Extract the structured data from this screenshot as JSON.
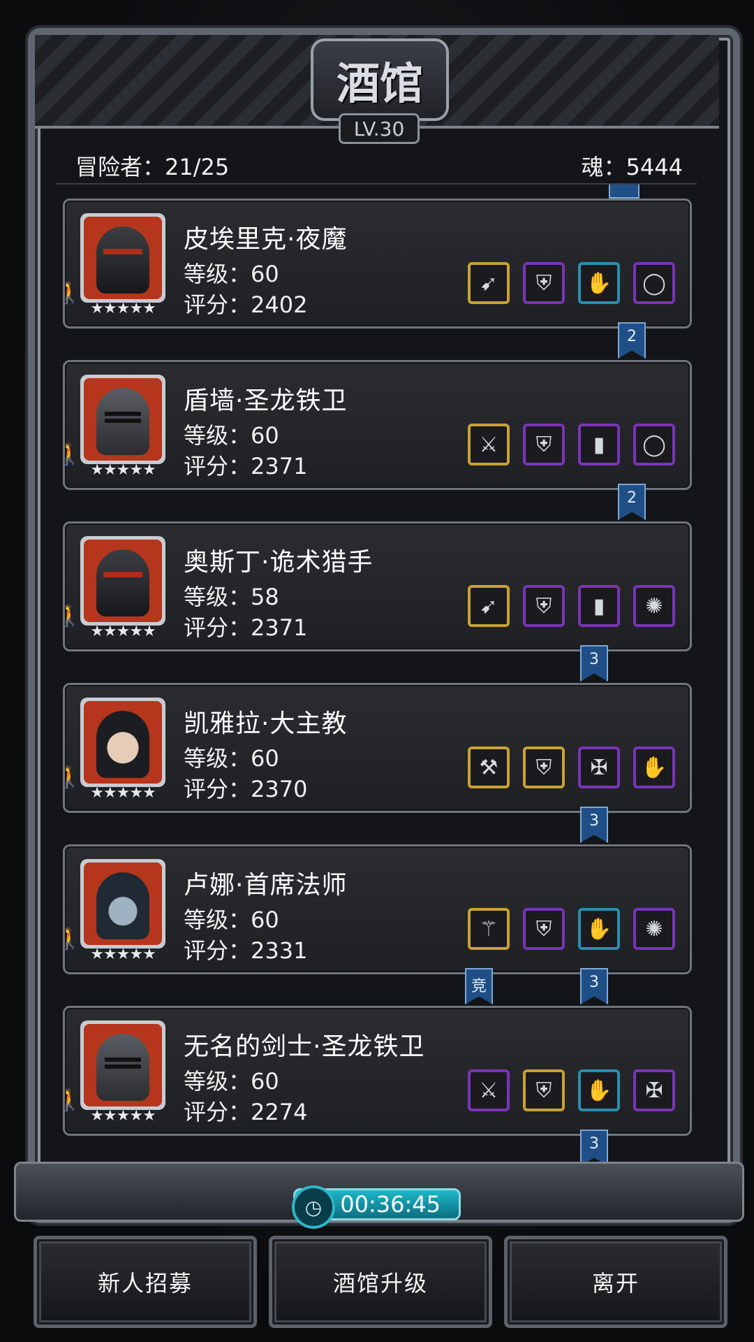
{
  "header": {
    "title": "酒馆",
    "level": "LV.30"
  },
  "stats": {
    "adventurers": "冒险者：21/25",
    "souls": "魂：5444"
  },
  "heroes": [
    {
      "name": "皮埃里克·夜魔",
      "level": "等级：60",
      "score": "评分：2402",
      "stars": "★★★★★",
      "portrait": "ninja-portrait-icon",
      "equipment": [
        {
          "icon": "curved-blade-icon",
          "glyph": "➹",
          "quality": "gold"
        },
        {
          "icon": "purple-armor-icon",
          "glyph": "⛨",
          "quality": "purple"
        },
        {
          "icon": "gauntlet-icon",
          "glyph": "✋",
          "quality": "blue"
        },
        {
          "icon": "ring-icon",
          "glyph": "◯",
          "quality": "purple"
        }
      ],
      "ribbons": [
        {
          "label": "2"
        }
      ]
    },
    {
      "name": "盾墙·圣龙铁卫",
      "level": "等级：60",
      "score": "评分：2371",
      "stars": "★★★★★",
      "portrait": "knight-portrait-icon",
      "equipment": [
        {
          "icon": "greatsword-icon",
          "glyph": "⚔",
          "quality": "gold"
        },
        {
          "icon": "plate-armor-icon",
          "glyph": "⛨",
          "quality": "purple"
        },
        {
          "icon": "wooden-shield-icon",
          "glyph": "▮",
          "quality": "purple"
        },
        {
          "icon": "ring-icon",
          "glyph": "◯",
          "quality": "purple"
        }
      ],
      "ribbons": [
        {
          "label": "2"
        }
      ]
    },
    {
      "name": "奥斯丁·诡术猎手",
      "level": "等级：58",
      "score": "评分：2371",
      "stars": "★★★★★",
      "portrait": "ninja-portrait-icon",
      "equipment": [
        {
          "icon": "curved-blade-icon",
          "glyph": "➹",
          "quality": "gold"
        },
        {
          "icon": "purple-armor-icon",
          "glyph": "⛨",
          "quality": "purple"
        },
        {
          "icon": "wooden-shield-icon",
          "glyph": "▮",
          "quality": "purple"
        },
        {
          "icon": "ruby-amulet-icon",
          "glyph": "✺",
          "quality": "purple"
        }
      ],
      "ribbons": [
        {
          "label": "3"
        }
      ]
    },
    {
      "name": "凯雅拉·大主教",
      "level": "等级：60",
      "score": "评分：2370",
      "stars": "★★★★★",
      "portrait": "priestess-portrait-icon",
      "equipment": [
        {
          "icon": "warhammer-icon",
          "glyph": "⚒",
          "quality": "gold"
        },
        {
          "icon": "purple-armor-icon",
          "glyph": "⛨",
          "quality": "gold"
        },
        {
          "icon": "cross-amulet-icon",
          "glyph": "✠",
          "quality": "purple"
        },
        {
          "icon": "gauntlet-icon",
          "glyph": "✋",
          "quality": "purple"
        }
      ],
      "ribbons": [
        {
          "label": "3"
        }
      ]
    },
    {
      "name": "卢娜·首席法师",
      "level": "等级：60",
      "score": "评分：2331",
      "stars": "★★★★★",
      "portrait": "mage-portrait-icon",
      "equipment": [
        {
          "icon": "staff-icon",
          "glyph": "⚚",
          "quality": "gold"
        },
        {
          "icon": "purple-armor-icon",
          "glyph": "⛨",
          "quality": "purple"
        },
        {
          "icon": "gauntlet-icon",
          "glyph": "✋",
          "quality": "blue"
        },
        {
          "icon": "ruby-amulet-icon",
          "glyph": "✺",
          "quality": "purple"
        }
      ],
      "ribbons": [
        {
          "label": "竞"
        },
        {
          "label": "3"
        }
      ]
    },
    {
      "name": "无名的剑士·圣龙铁卫",
      "level": "等级：60",
      "score": "评分：2274",
      "stars": "★★★★★",
      "portrait": "knight-portrait-icon",
      "equipment": [
        {
          "icon": "greatsword-icon",
          "glyph": "⚔",
          "quality": "purple"
        },
        {
          "icon": "leather-armor-icon",
          "glyph": "⛨",
          "quality": "gold"
        },
        {
          "icon": "gauntlet-icon",
          "glyph": "✋",
          "quality": "blue"
        },
        {
          "icon": "cross-amulet-icon",
          "glyph": "✠",
          "quality": "purple"
        }
      ],
      "ribbons": [
        {
          "label": "3"
        }
      ]
    }
  ],
  "timer": "00:36:45",
  "buttons": {
    "recruit": "新人招募",
    "upgrade": "酒馆升级",
    "leave": "离开"
  },
  "colors": {
    "gold": "#c9a233",
    "purple": "#7a34b8",
    "blue": "#2a8fb0",
    "portrait_bg": "#b5361c",
    "ribbon": "#1f4f86"
  }
}
